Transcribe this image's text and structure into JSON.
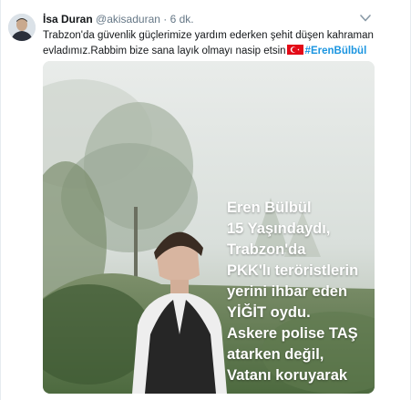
{
  "tweet": {
    "author_name": "İsa Duran",
    "handle": "@akisaduran",
    "separator": "·",
    "time": "6 dk.",
    "text_line1": "Trabzon'da güvenlik güçlerimize yardım ederken şehit düşen kahraman",
    "text_line2": "evladımız.Rabbim bize sana layık olmayı nasip etsin",
    "hashtag": "#ErenBülbül",
    "icons": {
      "menu": "chevron-down-icon",
      "flag": "turkey-flag-icon"
    }
  },
  "media": {
    "overlay_lines": [
      "Eren Bülbül",
      "15 Yaşındaydı,",
      "Trabzon'da",
      "PKK'lı teröristlerin",
      "yerini ihbar eden",
      "YİĞİT oydu.",
      "Askere polise TAŞ",
      "atarken değil,",
      "Vatanı koruyarak"
    ]
  },
  "colors": {
    "link": "#1b95e0",
    "muted": "#657786",
    "text": "#14171a"
  }
}
